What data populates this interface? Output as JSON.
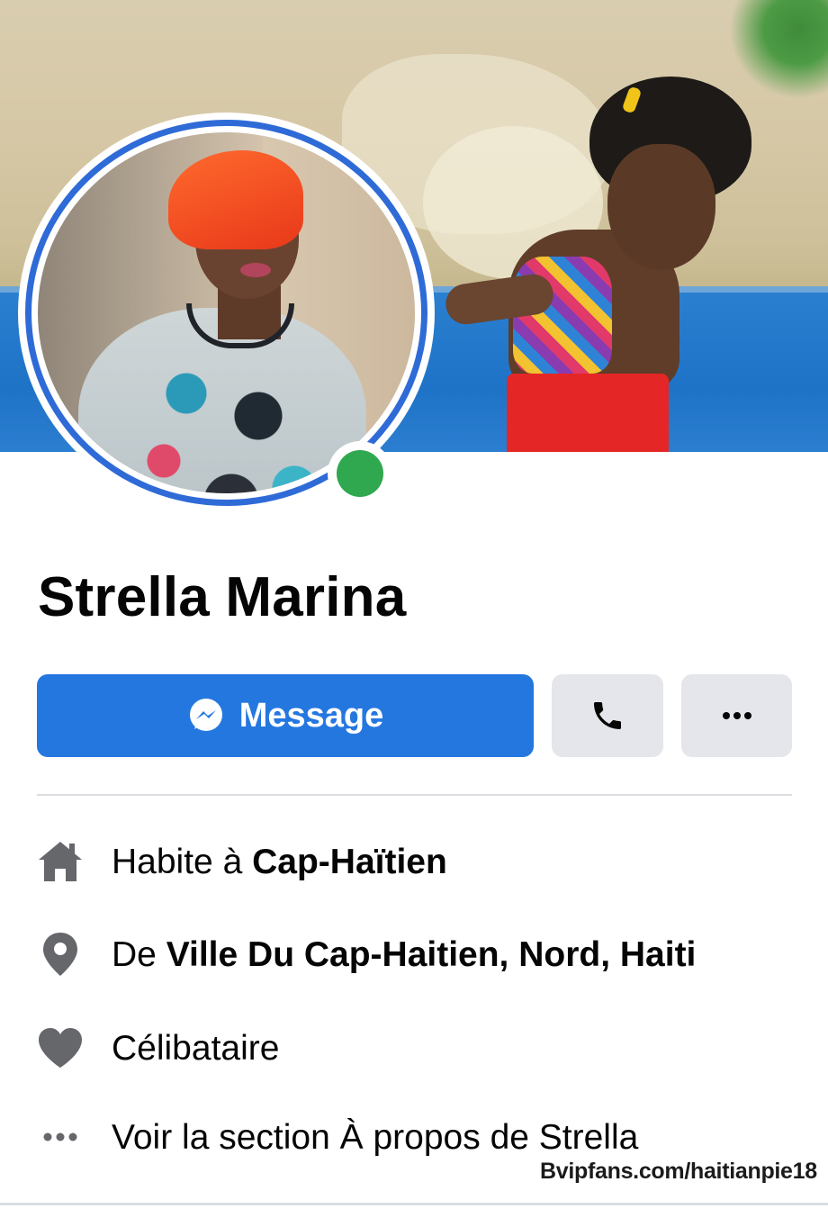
{
  "profile": {
    "name": "Strella Marina",
    "online": true
  },
  "actions": {
    "message_label": "Message",
    "call_icon": "phone-icon",
    "more_icon": "more-horizontal-icon"
  },
  "intro": {
    "lives_in_prefix": "Habite à",
    "lives_in_place": "Cap-Haïtien",
    "from_prefix": "De",
    "from_place": "Ville Du Cap-Haitien, Nord, Haiti",
    "relationship": "Célibataire",
    "see_about": "Voir la section À propos de Strella"
  },
  "watermark": "Bvipfans.com/haitianpie18",
  "colors": {
    "accent": "#2577e0",
    "online": "#2fa84f",
    "icon_gray": "#65676b",
    "button_gray": "#e4e6eb"
  }
}
